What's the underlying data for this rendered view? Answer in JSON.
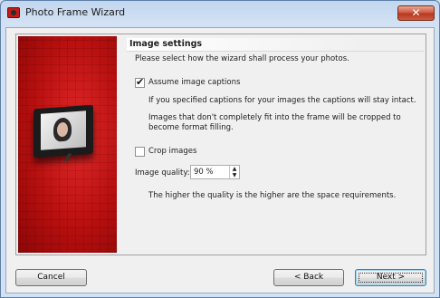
{
  "window": {
    "title": "Photo Frame Wizard",
    "close_label": "✕"
  },
  "section": {
    "title": "Image settings",
    "intro": "Please select how the wizard shall process your photos."
  },
  "options": {
    "captions": {
      "label": "Assume image captions",
      "checked": true,
      "description1": "If you specified captions for your images the captions will stay intact.",
      "description2": "Images that don't completely fit into the frame will be cropped to become format filling."
    },
    "crop": {
      "label": "Crop images",
      "checked": false
    },
    "quality": {
      "label": "Image quality:",
      "value": "90 %",
      "hint": "The higher the quality is the higher are the space requirements."
    }
  },
  "buttons": {
    "cancel": "Cancel",
    "back": "< Back",
    "next": "Next >"
  },
  "icons": {
    "spin_up": "▲",
    "spin_down": "▼"
  },
  "colors": {
    "accent_red": "#c41b1b",
    "close_button": "#c9553a",
    "focus_border": "#3c7fb1"
  }
}
